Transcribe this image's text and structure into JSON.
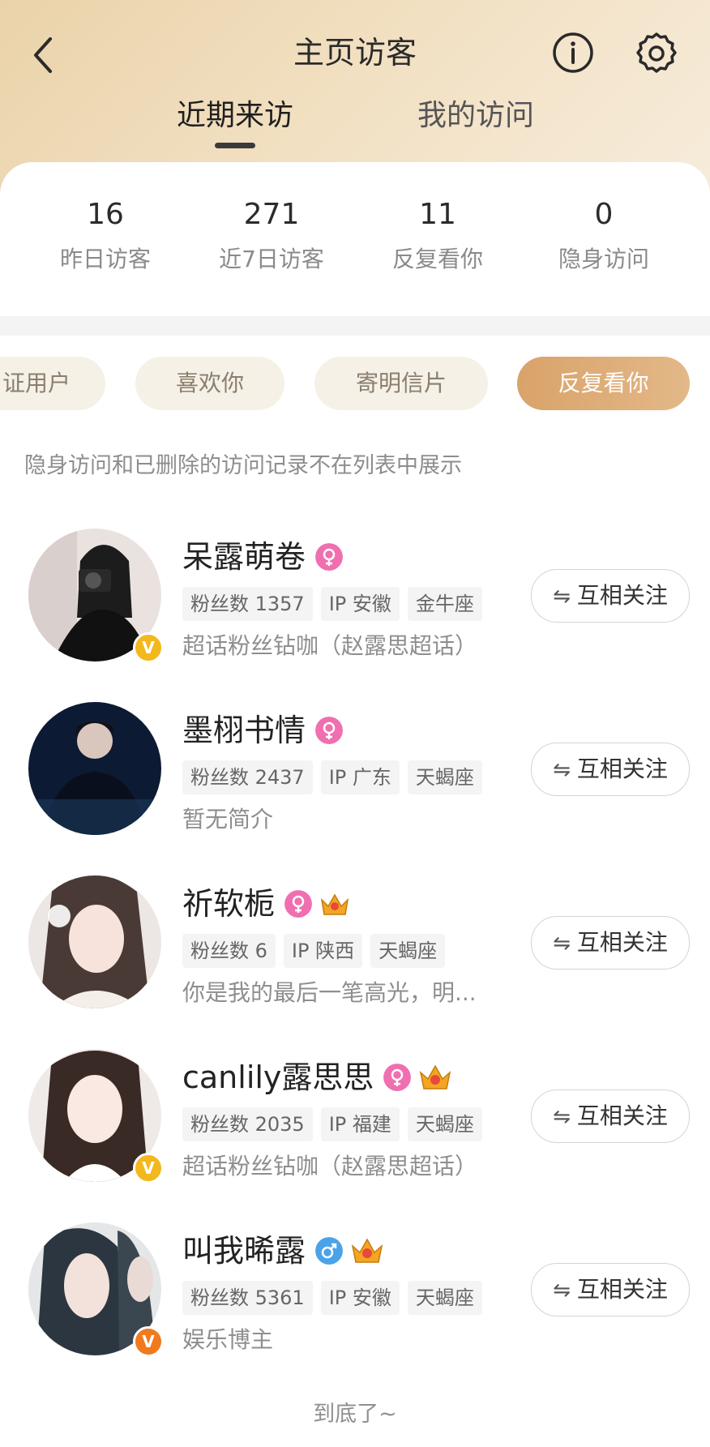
{
  "header": {
    "title": "主页访客",
    "tabs": [
      {
        "label": "近期来访",
        "active": true
      },
      {
        "label": "我的访问",
        "active": false
      }
    ]
  },
  "stats": [
    {
      "value": "16",
      "label": "昨日访客"
    },
    {
      "value": "271",
      "label": "近7日访客"
    },
    {
      "value": "11",
      "label": "反复看你"
    },
    {
      "value": "0",
      "label": "隐身访问"
    }
  ],
  "filters": [
    {
      "label": "证用户",
      "active": false
    },
    {
      "label": "喜欢你",
      "active": false
    },
    {
      "label": "寄明信片",
      "active": false
    },
    {
      "label": "反复看你",
      "active": true
    }
  ],
  "notice": "隐身访问和已删除的访问记录不在列表中展示",
  "visitors": [
    {
      "name": "呆露萌卷",
      "gender": "female",
      "crown": false,
      "verified": "gold",
      "fans": "粉丝数 1357",
      "ip": "IP 安徽",
      "zodiac": "金牛座",
      "bio": "超话粉丝钻咖（赵露思超话）",
      "follow": "互相关注"
    },
    {
      "name": "墨栩书情",
      "gender": "female",
      "crown": false,
      "verified": "none",
      "fans": "粉丝数 2437",
      "ip": "IP 广东",
      "zodiac": "天蝎座",
      "bio": "暂无简介",
      "follow": "互相关注"
    },
    {
      "name": "祈软栀",
      "gender": "female",
      "crown": true,
      "verified": "none",
      "fans": "粉丝数 6",
      "ip": "IP 陕西",
      "zodiac": "天蝎座",
      "bio": "你是我的最后一笔高光，明...",
      "follow": "互相关注"
    },
    {
      "name": "canlily露思思",
      "gender": "female",
      "crown": true,
      "verified": "gold",
      "fans": "粉丝数 2035",
      "ip": "IP 福建",
      "zodiac": "天蝎座",
      "bio": "超话粉丝钻咖（赵露思超话）",
      "follow": "互相关注"
    },
    {
      "name": "叫我晞露",
      "gender": "male",
      "crown": true,
      "verified": "orange",
      "fans": "粉丝数 5361",
      "ip": "IP 安徽",
      "zodiac": "天蝎座",
      "bio": "娱乐博主",
      "follow": "互相关注"
    }
  ],
  "footer": "到底了~",
  "icons": {
    "back": "chevron-left-icon",
    "info": "info-circle-icon",
    "settings": "gear-icon",
    "mutual": "swap-arrows-icon"
  },
  "colors": {
    "accent": "#dca56c",
    "female": "#ef6fb0",
    "male": "#4aa3e8",
    "verified_gold": "#f2b81d",
    "verified_orange": "#f07a1e"
  }
}
